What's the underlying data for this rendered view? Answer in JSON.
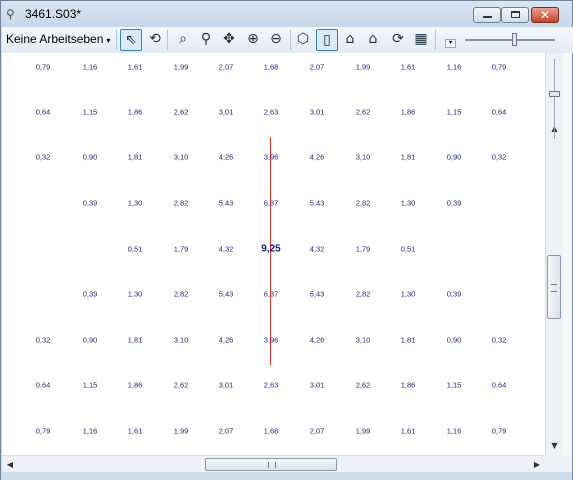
{
  "window": {
    "title": "3461.S03*",
    "min_glyph": "",
    "close_glyph": "✕"
  },
  "toolbar": {
    "layer_dropdown": "Keine Arbeitseben",
    "layer_caret": "▾",
    "dropdown_arrow": "▾",
    "buttons": [
      {
        "name": "select-pointer-icon",
        "glyph": "⇖"
      },
      {
        "name": "rotate-view-icon",
        "glyph": "⟲"
      },
      {
        "name": "zoom-window-icon",
        "glyph": "⌕"
      },
      {
        "name": "zoom-icon",
        "glyph": "⚲"
      },
      {
        "name": "pan-icon",
        "glyph": "✥"
      },
      {
        "name": "zoom-in-icon",
        "glyph": "⊕"
      },
      {
        "name": "zoom-out-icon",
        "glyph": "⊖"
      },
      {
        "name": "3d-view-icon",
        "glyph": "⬡"
      },
      {
        "name": "plan-view-icon",
        "glyph": "▯"
      },
      {
        "name": "house-icon",
        "glyph": "⌂"
      },
      {
        "name": "building-icon",
        "glyph": "⌂"
      },
      {
        "name": "refresh-icon",
        "glyph": "⟳"
      },
      {
        "name": "grid-icon",
        "glyph": "▦"
      }
    ]
  },
  "grid": {
    "rows": [
      [
        "0,79",
        "1,16",
        "1,61",
        "1,99",
        "2,07",
        "1,68",
        "2,07",
        "1,99",
        "1,61",
        "1,16",
        "0,79"
      ],
      [
        "0,64",
        "1,15",
        "1,86",
        "2,62",
        "3,01",
        "2,63",
        "3,01",
        "2,62",
        "1,86",
        "1,15",
        "0,64"
      ],
      [
        "0,32",
        "0,90",
        "1,81",
        "3,10",
        "4,26",
        "3,96",
        "4,26",
        "3,10",
        "1,81",
        "0,90",
        "0,32"
      ],
      [
        "",
        "0,39",
        "1,30",
        "2,82",
        "5,43",
        "6,37",
        "5,43",
        "2,82",
        "1,30",
        "0,39",
        ""
      ],
      [
        "",
        "",
        "0,51",
        "1,79",
        "4,32",
        "9,25",
        "4,32",
        "1,79",
        "0,51",
        "",
        ""
      ],
      [
        "",
        "0,39",
        "1,30",
        "2,82",
        "5,43",
        "6,37",
        "5,43",
        "2,82",
        "1,30",
        "0,39",
        ""
      ],
      [
        "0,32",
        "0,90",
        "1,81",
        "3,10",
        "4,26",
        "3,96",
        "4,26",
        "3,10",
        "1,81",
        "0,90",
        "0,32"
      ],
      [
        "0,64",
        "1,15",
        "1,86",
        "2,62",
        "3,01",
        "2,63",
        "3,01",
        "2,62",
        "1,86",
        "1,15",
        "0,64"
      ],
      [
        "0,79",
        "1,16",
        "1,61",
        "1,99",
        "2,07",
        "1,68",
        "2,07",
        "1,99",
        "1,61",
        "1,16",
        "0,79"
      ]
    ],
    "peak_value": "9,25",
    "value_color": "#1a2a70",
    "section_line_color": "#e03030"
  },
  "scrollbars": {
    "up": "▲",
    "down": "▼",
    "left": "◀",
    "right": "▶"
  }
}
